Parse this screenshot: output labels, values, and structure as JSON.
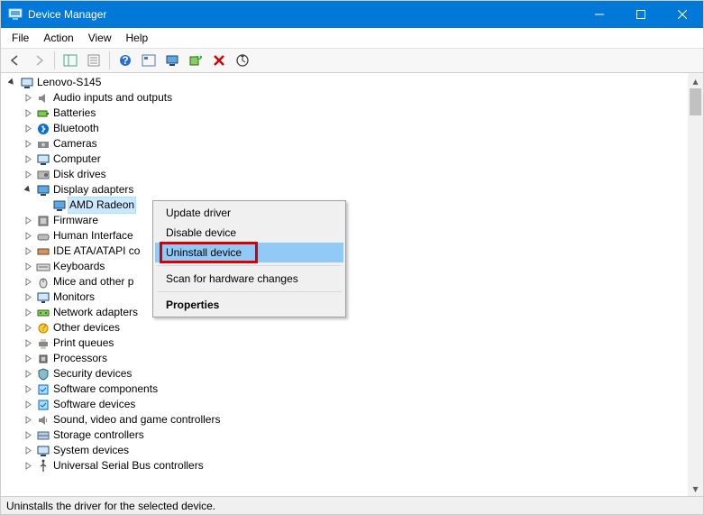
{
  "titlebar": {
    "title": "Device Manager"
  },
  "menubar": {
    "items": [
      "File",
      "Action",
      "View",
      "Help"
    ]
  },
  "toolbar": {
    "buttons": [
      {
        "name": "back-icon"
      },
      {
        "name": "forward-icon"
      },
      {
        "name": "show-hide-tree-icon"
      },
      {
        "name": "properties-icon"
      },
      {
        "name": "help-icon"
      },
      {
        "name": "show-hidden-icon"
      },
      {
        "name": "monitor-icon"
      },
      {
        "name": "add-hardware-icon"
      },
      {
        "name": "remove-icon"
      },
      {
        "name": "scan-hardware-icon"
      }
    ]
  },
  "tree": {
    "root": {
      "label": "Lenovo-S145",
      "expanded": true
    },
    "categories": [
      {
        "label": "Audio inputs and outputs",
        "icon": "speaker",
        "expanded": false
      },
      {
        "label": "Batteries",
        "icon": "battery",
        "expanded": false
      },
      {
        "label": "Bluetooth",
        "icon": "bluetooth",
        "expanded": false
      },
      {
        "label": "Cameras",
        "icon": "camera",
        "expanded": false
      },
      {
        "label": "Computer",
        "icon": "computer",
        "expanded": false
      },
      {
        "label": "Disk drives",
        "icon": "disk",
        "expanded": false
      },
      {
        "label": "Display adapters",
        "icon": "display",
        "expanded": true,
        "children": [
          {
            "label": "AMD Radeon",
            "icon": "display",
            "selected": true
          }
        ]
      },
      {
        "label": "Firmware",
        "icon": "firmware",
        "expanded": false
      },
      {
        "label": "Human Interface",
        "icon": "hid",
        "expanded": false
      },
      {
        "label": "IDE ATA/ATAPI co",
        "icon": "ide",
        "expanded": false
      },
      {
        "label": "Keyboards",
        "icon": "keyboard",
        "expanded": false
      },
      {
        "label": "Mice and other p",
        "icon": "mouse",
        "expanded": false
      },
      {
        "label": "Monitors",
        "icon": "monitor",
        "expanded": false
      },
      {
        "label": "Network adapters",
        "icon": "network",
        "expanded": false
      },
      {
        "label": "Other devices",
        "icon": "other",
        "expanded": false
      },
      {
        "label": "Print queues",
        "icon": "printer",
        "expanded": false
      },
      {
        "label": "Processors",
        "icon": "cpu",
        "expanded": false
      },
      {
        "label": "Security devices",
        "icon": "security",
        "expanded": false
      },
      {
        "label": "Software components",
        "icon": "software",
        "expanded": false
      },
      {
        "label": "Software devices",
        "icon": "software",
        "expanded": false
      },
      {
        "label": "Sound, video and game controllers",
        "icon": "sound",
        "expanded": false
      },
      {
        "label": "Storage controllers",
        "icon": "storage",
        "expanded": false
      },
      {
        "label": "System devices",
        "icon": "system",
        "expanded": false
      },
      {
        "label": "Universal Serial Bus controllers",
        "icon": "usb",
        "expanded": false
      }
    ]
  },
  "context_menu": {
    "items": [
      {
        "label": "Update driver",
        "kind": "item"
      },
      {
        "label": "Disable device",
        "kind": "item"
      },
      {
        "label": "Uninstall device",
        "kind": "item",
        "highlighted": true,
        "boxed": true
      },
      {
        "kind": "sep"
      },
      {
        "label": "Scan for hardware changes",
        "kind": "item"
      },
      {
        "kind": "sep"
      },
      {
        "label": "Properties",
        "kind": "item",
        "bold": true
      }
    ]
  },
  "statusbar": {
    "text": "Uninstalls the driver for the selected device."
  }
}
